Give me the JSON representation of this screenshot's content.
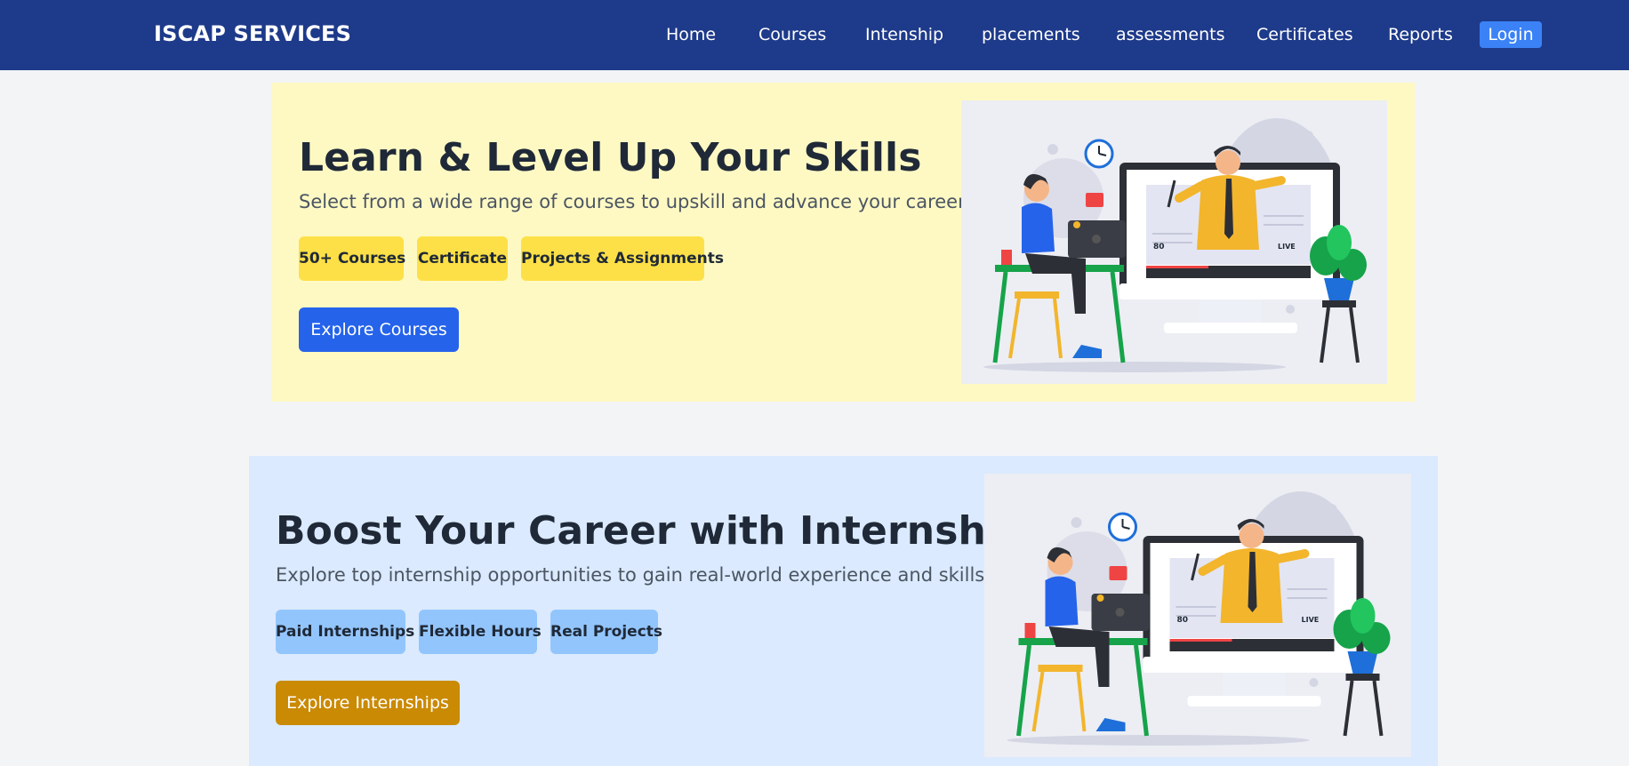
{
  "navbar": {
    "brand": "ISCAP SERVICES",
    "links": [
      "Home",
      "Courses",
      "Intenship",
      "placements",
      "assessments",
      "Certificates",
      "Reports"
    ],
    "login": "Login"
  },
  "courses_card": {
    "title": "Learn & Level Up Your Skills",
    "subtitle": "Select from a wide range of courses to upskill and advance your career!",
    "tags": [
      "50+ Courses",
      "Certificate",
      "Projects & Assignments"
    ],
    "cta": "Explore Courses",
    "illustration": {
      "viewers": "80",
      "live": "LIVE"
    }
  },
  "internship_card": {
    "title": "Boost Your Career with Internships",
    "subtitle": "Explore top internship opportunities to gain real-world experience and skills!",
    "tags": [
      "Paid Internships",
      "Flexible Hours",
      "Real Projects"
    ],
    "cta": "Explore Internships",
    "illustration": {
      "viewers": "80",
      "live": "LIVE"
    }
  },
  "colors": {
    "navbar": "#1e3a8a",
    "login": "#3b82f6",
    "courses_bg": "#fef9c3",
    "courses_tag": "#fde047",
    "courses_cta": "#2563eb",
    "internship_bg": "#dbeafe",
    "internship_tag": "#93c5fd",
    "internship_cta": "#ca8a04"
  }
}
